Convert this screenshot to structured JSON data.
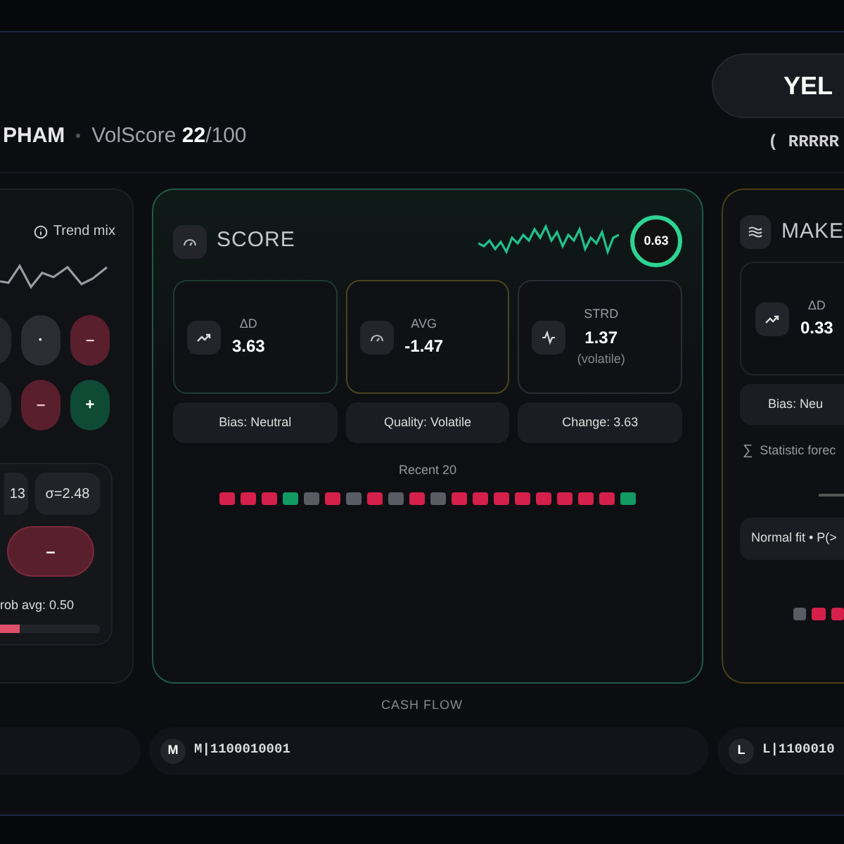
{
  "header": {
    "name": "PHAM",
    "score_label": "VolScore",
    "score": "22",
    "score_max": "/100",
    "pill": "YEL",
    "code": "( RRRRR"
  },
  "left_card": {
    "legend": "Trend mix",
    "dots": [
      {
        "symbol": "·",
        "kind": "neutral"
      },
      {
        "symbol": "–",
        "kind": "down"
      },
      {
        "symbol": "–",
        "kind": "down"
      },
      {
        "symbol": "+",
        "kind": "up"
      }
    ],
    "chips": [
      "13",
      "σ=2.48"
    ],
    "action": "–",
    "prob": "rob avg: 0.50",
    "level": 0.2
  },
  "score_card": {
    "title": "SCORE",
    "gauge": "0.63",
    "stats": [
      {
        "label": "ΔD",
        "value": "3.63",
        "color": "#1f3a31"
      },
      {
        "label": "AVG",
        "value": "-1.47",
        "color": "#4a4520"
      },
      {
        "label": "STRD",
        "value": "1.37",
        "note": "(volatile)",
        "color": "#2a2d33"
      }
    ],
    "tags": [
      "Bias: Neutral",
      "Quality: Volatile",
      "Change: 3.63"
    ],
    "recent_label": "Recent 20",
    "recent": [
      {
        "color": "#d4204a"
      },
      {
        "color": "#d4204a"
      },
      {
        "color": "#d4204a"
      },
      {
        "color": "#129a63"
      },
      {
        "color": "#5a5c63"
      },
      {
        "color": "#d4204a"
      },
      {
        "color": "#5a5c63"
      },
      {
        "color": "#d4204a"
      },
      {
        "color": "#5a5c63"
      },
      {
        "color": "#d4204a"
      },
      {
        "color": "#5a5c63"
      },
      {
        "color": "#d4204a"
      },
      {
        "color": "#d4204a"
      },
      {
        "color": "#d4204a"
      },
      {
        "color": "#d4204a"
      },
      {
        "color": "#d4204a"
      },
      {
        "color": "#d4204a"
      },
      {
        "color": "#d4204a"
      },
      {
        "color": "#d4204a"
      },
      {
        "color": "#129a63"
      }
    ]
  },
  "right_card": {
    "title": "MAKE",
    "stat": {
      "label": "ΔD",
      "value": "0.33"
    },
    "tag": "Bias: Neu",
    "forecast_symbol": "∑",
    "forecast": "Statistic forec",
    "fit": "Normal fit • P(>",
    "recent": [
      {
        "color": "#5a5c63"
      },
      {
        "color": "#d4204a"
      },
      {
        "color": "#d4204a"
      }
    ]
  },
  "cash_flow": {
    "title": "CASH FLOW",
    "items": [
      {
        "badge": "M",
        "value": "M|1100010001"
      },
      {
        "badge": "L",
        "value": "L|1100010"
      }
    ]
  }
}
